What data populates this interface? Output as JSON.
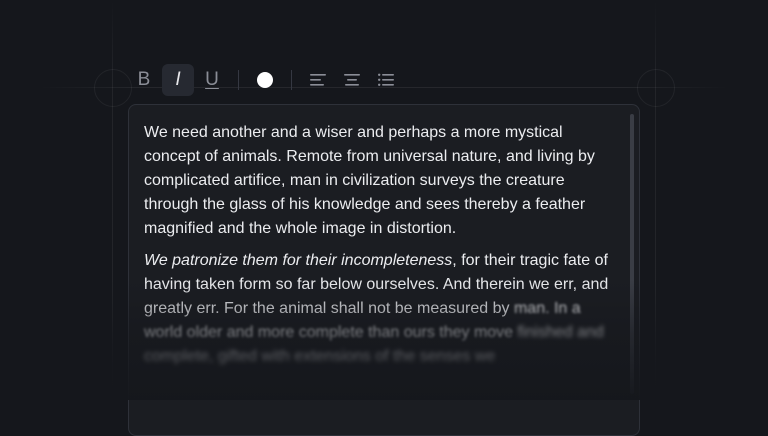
{
  "toolbar": {
    "bold_label": "B",
    "italic_label": "I",
    "underline_label": "U",
    "text_color": "#ffffff"
  },
  "editor": {
    "paragraph1": "We need another and a wiser and perhaps a more mystical concept of animals. Remote from universal nature, and living by complicated artifice, man in civilization surveys the creature through the glass of his knowledge and sees thereby a feather magnified and the whole image in distortion.",
    "paragraph2_italic": "We patronize them for their incompleteness",
    "paragraph2_rest": ", for their tragic fate of having taken form so far below ourselves. And therein we err, and greatly err. For the animal shall not be measured by",
    "paragraph2_blur1": "man. In a world older and more complete than ours they move",
    "paragraph2_blur2": "finished and complete, gifted with extensions of the senses we"
  },
  "colors": {
    "background": "#15171c",
    "editor_background": "#1b1d22",
    "active_button": "#262931"
  }
}
